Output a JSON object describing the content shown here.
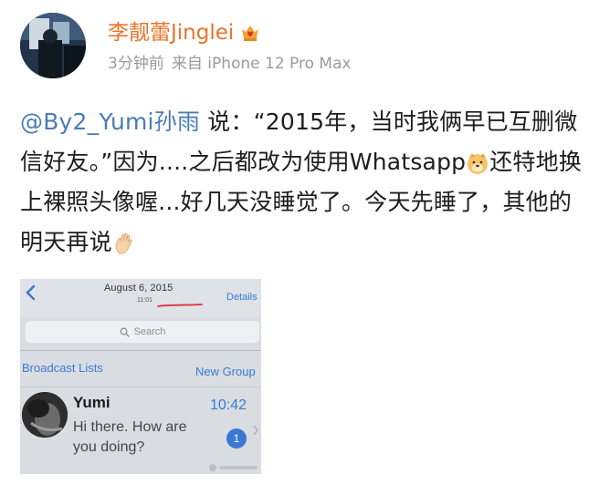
{
  "header": {
    "username": "李靓蕾Jinglei",
    "time_ago": "3分钟前",
    "source": "来自 iPhone 12 Pro Max"
  },
  "post": {
    "mention": "@By2_Yumi孙雨",
    "text_1": " 说：“2015年，当时我俩早已互删微信好友。”因为....之后都改为使用Whatsapp",
    "text_2": "还特地换上裸照头像喔...好几天没睡觉了。今天先睡了，其他的明天再说"
  },
  "screenshot": {
    "date": "August 6, 2015",
    "time": "11:01",
    "details_label": "Details",
    "search_placeholder": "Search",
    "broadcast_label": "Broadcast Lists",
    "new_group_label": "New Group",
    "chat": {
      "name": "Yumi",
      "time": "10:42",
      "preview": "Hi there. How are you doing?",
      "unread": "1"
    }
  },
  "icons": {
    "vip": "gold-crown-heart-icon",
    "emoji_1": "doge-face-icon",
    "emoji_2": "waving-hand-icon",
    "back": "chevron-left-icon",
    "search": "search-icon",
    "forward": "chevron-right-icon"
  },
  "colors": {
    "username": "#e8742b",
    "mention": "#4a7bb7",
    "ios_blue": "#3a78d4",
    "meta_gray": "#9a9a9a"
  }
}
